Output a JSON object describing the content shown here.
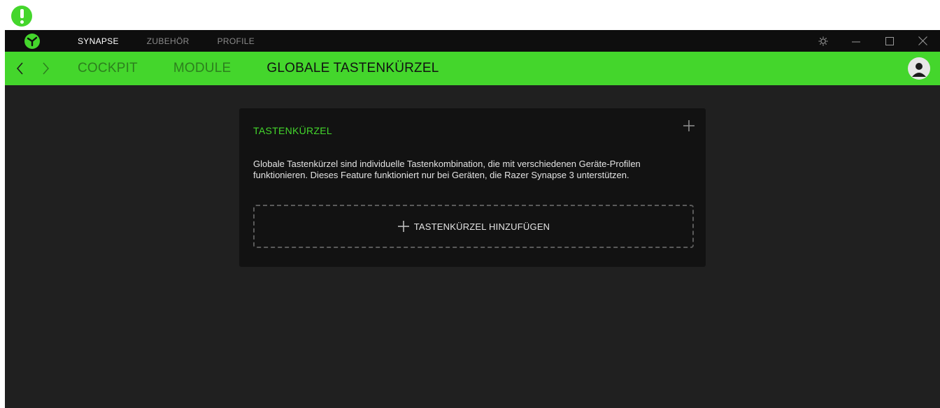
{
  "alert": {
    "icon": "exclamation-icon"
  },
  "titlebar": {
    "logo_icon": "razer-logo-icon",
    "tabs": [
      {
        "label": "SYNAPSE",
        "active": true
      },
      {
        "label": "ZUBEHÖR",
        "active": false
      },
      {
        "label": "PROFILE",
        "active": false
      }
    ],
    "controls": [
      "settings-icon",
      "minimize-icon",
      "maximize-icon",
      "close-icon"
    ]
  },
  "subnav": {
    "back_icon": "chevron-left-icon",
    "forward_icon": "chevron-right-icon",
    "tabs": [
      {
        "label": "COCKPIT",
        "active": false
      },
      {
        "label": "MODULE",
        "active": false
      },
      {
        "label": "GLOBALE TASTENKÜRZEL",
        "active": true
      }
    ],
    "account_icon": "user-avatar-icon"
  },
  "card": {
    "title": "TASTENKÜRZEL",
    "add_icon": "plus-icon",
    "description": "Globale Tastenkürzel sind individuelle Tastenkombination, die mit verschiedenen Geräte-Profilen funktionieren. Dieses Feature funktioniert nur bei Geräten, die Razer Synapse 3 unterstützen.",
    "add_button_label": "TASTENKÜRZEL HINZUFÜGEN"
  },
  "colors": {
    "accent": "#44d62c",
    "window_bg": "#202020",
    "titlebar_bg": "#0e0e0e",
    "card_bg": "#121212"
  }
}
